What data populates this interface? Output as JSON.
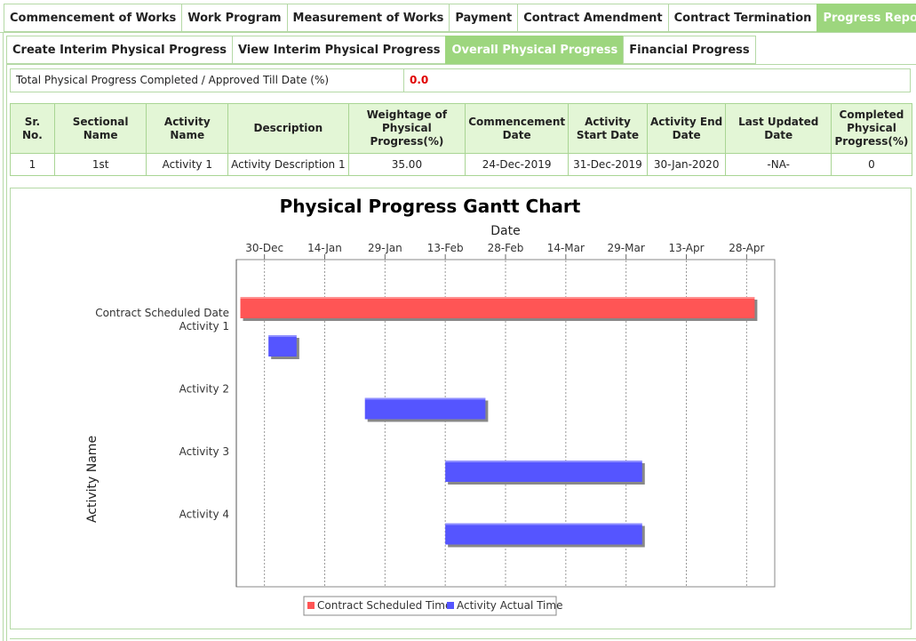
{
  "top_tabs": [
    {
      "label": "Commencement of Works",
      "active": false
    },
    {
      "label": "Work Program",
      "active": false
    },
    {
      "label": "Measurement of Works",
      "active": false
    },
    {
      "label": "Payment",
      "active": false
    },
    {
      "label": "Contract Amendment",
      "active": false
    },
    {
      "label": "Contract Termination",
      "active": false
    },
    {
      "label": "Progress Report",
      "active": true
    }
  ],
  "sub_tabs": [
    {
      "label": "Create Interim Physical Progress",
      "active": false
    },
    {
      "label": "View Interim Physical Progress",
      "active": false
    },
    {
      "label": "Overall Physical Progress",
      "active": true
    },
    {
      "label": "Financial Progress",
      "active": false
    }
  ],
  "summary": {
    "label": "Total Physical Progress Completed / Approved Till Date (%)",
    "value": "0.0"
  },
  "table": {
    "headers": [
      "Sr. No.",
      "Sectional Name",
      "Activity Name",
      "Description",
      "Weightage of Physical Progress(%)",
      "Commencement Date",
      "Activity Start Date",
      "Activity End Date",
      "Last Updated Date",
      "Completed Physical Progress(%)"
    ],
    "rows": [
      [
        "1",
        "1st",
        "Activity 1",
        "Activity Description 1",
        "35.00",
        "24-Dec-2019",
        "31-Dec-2019",
        "30-Jan-2020",
        "-NA-",
        "0"
      ]
    ]
  },
  "chart_data": {
    "type": "gantt",
    "title": "Physical Progress Gantt Chart",
    "xlabel": "Date",
    "ylabel": "Activity Name",
    "x_ticks": [
      "30-Dec",
      "14-Jan",
      "29-Jan",
      "13-Feb",
      "28-Feb",
      "14-Mar",
      "29-Mar",
      "13-Apr",
      "28-Apr"
    ],
    "xlim": [
      "2019-12-23",
      "2020-05-05"
    ],
    "categories": [
      "Contract Scheduled Date",
      "Activity 1",
      "Activity 2",
      "Activity 3",
      "Activity 4"
    ],
    "series": [
      {
        "name": "Contract Scheduled Time",
        "color": "#ff5555",
        "tasks": [
          {
            "category": "Contract Scheduled Date",
            "start": "2019-12-24",
            "end": "2020-04-30"
          }
        ]
      },
      {
        "name": "Activity Actual Time",
        "color": "#5555ff",
        "tasks": [
          {
            "category": "Activity 1",
            "start": "2019-12-31",
            "end": "2020-01-07"
          },
          {
            "category": "Activity 2",
            "start": "2020-01-24",
            "end": "2020-02-23"
          },
          {
            "category": "Activity 3",
            "start": "2020-02-13",
            "end": "2020-04-02"
          },
          {
            "category": "Activity 4",
            "start": "2020-02-13",
            "end": "2020-04-02"
          }
        ]
      }
    ],
    "legend_position": "bottom",
    "grid": true
  }
}
